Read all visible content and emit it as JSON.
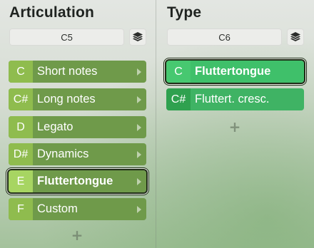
{
  "articulation": {
    "title": "Articulation",
    "range": "C5",
    "items": [
      {
        "key": "C",
        "label": "Short notes"
      },
      {
        "key": "C#",
        "label": "Long notes"
      },
      {
        "key": "D",
        "label": "Legato"
      },
      {
        "key": "D#",
        "label": "Dynamics"
      },
      {
        "key": "E",
        "label": "Fluttertongue",
        "selected": true
      },
      {
        "key": "F",
        "label": "Custom"
      }
    ],
    "add_label": "+"
  },
  "type": {
    "title": "Type",
    "range": "C6",
    "items": [
      {
        "key": "C",
        "label": "Fluttertongue",
        "selected": true
      },
      {
        "key": "C#",
        "label": "Fluttert. cresc."
      }
    ],
    "add_label": "+"
  },
  "icons": {
    "layers": "layers-icon",
    "arrow": "chevron-right-icon"
  },
  "colors": {
    "articulation_item_bg": "#6f9a4a",
    "articulation_key_bg": "#8fbc4e",
    "type_item_bg": "#3fb364",
    "type_key_bg": "#2fa14f",
    "selection_outline": "#1d2a15"
  }
}
